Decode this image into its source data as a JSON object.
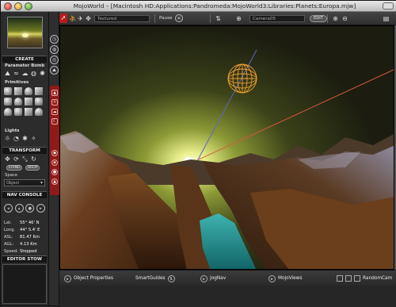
{
  "window": {
    "title": "MojoWorld – [Macintosh HD:Applications:Pandromeda:MojoWorld3:Libraries:Planets:Europa.mjw]"
  },
  "toolbar": {
    "render_mode": "Textured",
    "pause_label": "Pause",
    "camera": "Camera05",
    "edit_label": "EDIT"
  },
  "left_panel": {
    "create": {
      "header": "CREATE",
      "parameter_bomb": "Parameter Bomb",
      "primitives": "Primitives",
      "lights": "Lights"
    },
    "transform": {
      "header": "TRANSFORM",
      "stand_label": "STAND",
      "drop_label": "DROP",
      "space_label": "Space",
      "space_value": "Object"
    },
    "nav_console": {
      "header": "NAV CONSOLE",
      "rows": [
        {
          "key": "Lat.",
          "value": "55° 46' N"
        },
        {
          "key": "Long.",
          "value": "44° 5.4' E"
        },
        {
          "key": "ASL:",
          "value": "81.47 Km"
        },
        {
          "key": "AGL:",
          "value": "4.13 Km"
        },
        {
          "key": "Speed:",
          "value": "Stopped"
        }
      ]
    },
    "editor_stow": {
      "header": "EDITOR STOW"
    }
  },
  "bottom_bar": {
    "object_properties": "Object Properties",
    "smart_guides": "SmartGuides",
    "jog_nav": "JogNav",
    "mojo_views": "MojoViews",
    "random_cam": "RandomCam"
  },
  "colors": {
    "accent_red": "#b71c1c",
    "sky_top": "#1e1e12",
    "sky_glow": "#c9d35a",
    "water": "#1f8a8a"
  }
}
